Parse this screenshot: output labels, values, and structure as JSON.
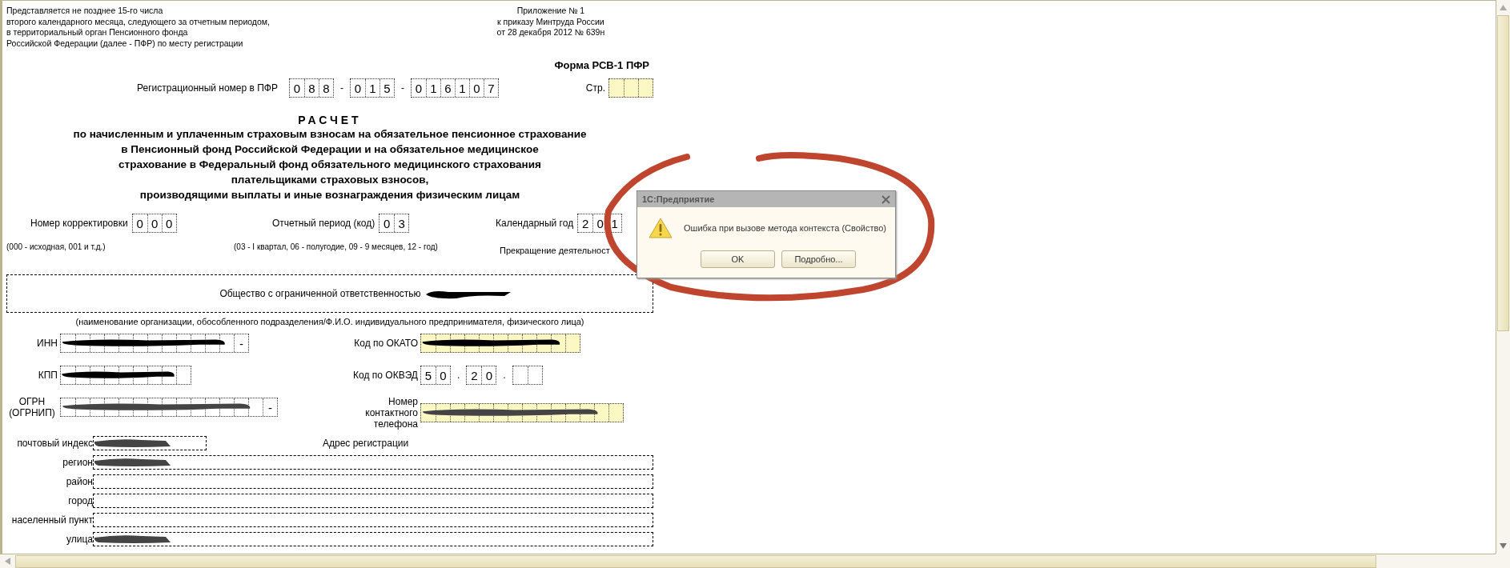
{
  "header_note": [
    "Представляется не позднее 15-го числа",
    "второго календарного месяца, следующего за отчетным периодом,",
    "в территориальный орган Пенсионного фонда",
    "Российской Федерации (далее - ПФР) по месту регистрации"
  ],
  "appendix": [
    "Приложение № 1",
    "к приказу Минтруда России",
    "от 28 декабря 2012 № 639н"
  ],
  "form_name": "Форма РСВ-1 ПФР",
  "reg_number": {
    "label": "Регистрационный номер в ПФР",
    "parts": [
      {
        "kind": "cells",
        "digits": [
          "0",
          "8",
          "8"
        ]
      },
      {
        "kind": "text",
        "text": "-"
      },
      {
        "kind": "cells",
        "digits": [
          "0",
          "1",
          "5"
        ]
      },
      {
        "kind": "text",
        "text": "-"
      },
      {
        "kind": "cells",
        "digits": [
          "0",
          "1",
          "6",
          "1",
          "0",
          "7"
        ]
      }
    ]
  },
  "page_field": {
    "label": "Стр.",
    "highlighted": true
  },
  "title": "РАСЧЕТ",
  "subtitle": [
    "по начисленным и уплаченным страховым взносам на обязательное пенсионное страхование",
    "в Пенсионный фонд Российской Федерации и на обязательное медицинское",
    "страхование в Федеральный фонд обязательного медицинского страхования",
    "плательщиками страховых взносов,",
    "производящими выплаты и иные вознаграждения физическим лицам"
  ],
  "codes": [
    {
      "label": "Номер корректировки",
      "digits": [
        "0",
        "0",
        "0"
      ]
    },
    {
      "label": "Отчетный период (код)",
      "digits": [
        "0",
        "3"
      ]
    },
    {
      "label": "Календарный год",
      "digits": [
        "2",
        "0",
        "1"
      ]
    }
  ],
  "hints": [
    "(000 - исходная, 001 и т.д.)",
    "(03 - I квартал, 06 - полугодие, 09 - 9 месяцев, 12 - год)",
    "Прекращение деятельност"
  ],
  "organization": {
    "text": "Общество с ограниченной ответственностью",
    "redacted": true,
    "caption": "(наименование организации, обособленного подразделения/Ф.И.О. индивидуального предпринимателя, физического лица)"
  },
  "ids_left": [
    {
      "label": "ИНН",
      "redacted": true,
      "suffix": "-"
    },
    {
      "label": "КПП",
      "redacted": true
    },
    {
      "label": "ОГРН (ОГРНИП)",
      "redacted": true,
      "suffix": "-"
    }
  ],
  "ids_right": [
    {
      "label": "Код по ОКАТО",
      "redacted": true,
      "highlighted": true
    },
    {
      "label": "Код по ОКВЭД",
      "parts": [
        {
          "kind": "cells",
          "digits": [
            "5",
            "0"
          ]
        },
        {
          "kind": "text",
          "text": "."
        },
        {
          "kind": "cells",
          "digits": [
            "2",
            "0"
          ]
        },
        {
          "kind": "text",
          "text": "."
        },
        {
          "kind": "blank_cells"
        }
      ]
    },
    {
      "label": "Номер контактного телефона",
      "redacted": true,
      "highlighted": true
    }
  ],
  "address": {
    "heading": "Адрес регистрации",
    "fields": [
      {
        "label": "почтовый индекс",
        "redacted": true
      },
      {
        "label": "регион",
        "redacted": true
      },
      {
        "label": "район"
      },
      {
        "label": "город"
      },
      {
        "label": "населенный пункт"
      },
      {
        "label": "улица",
        "redacted": true
      }
    ]
  },
  "dialog": {
    "title": "1С:Предприятие",
    "message": "Ошибка при вызове метода контекста (Свойство)",
    "buttons": [
      {
        "label": "OK"
      },
      {
        "label": "Подробно..."
      }
    ]
  }
}
